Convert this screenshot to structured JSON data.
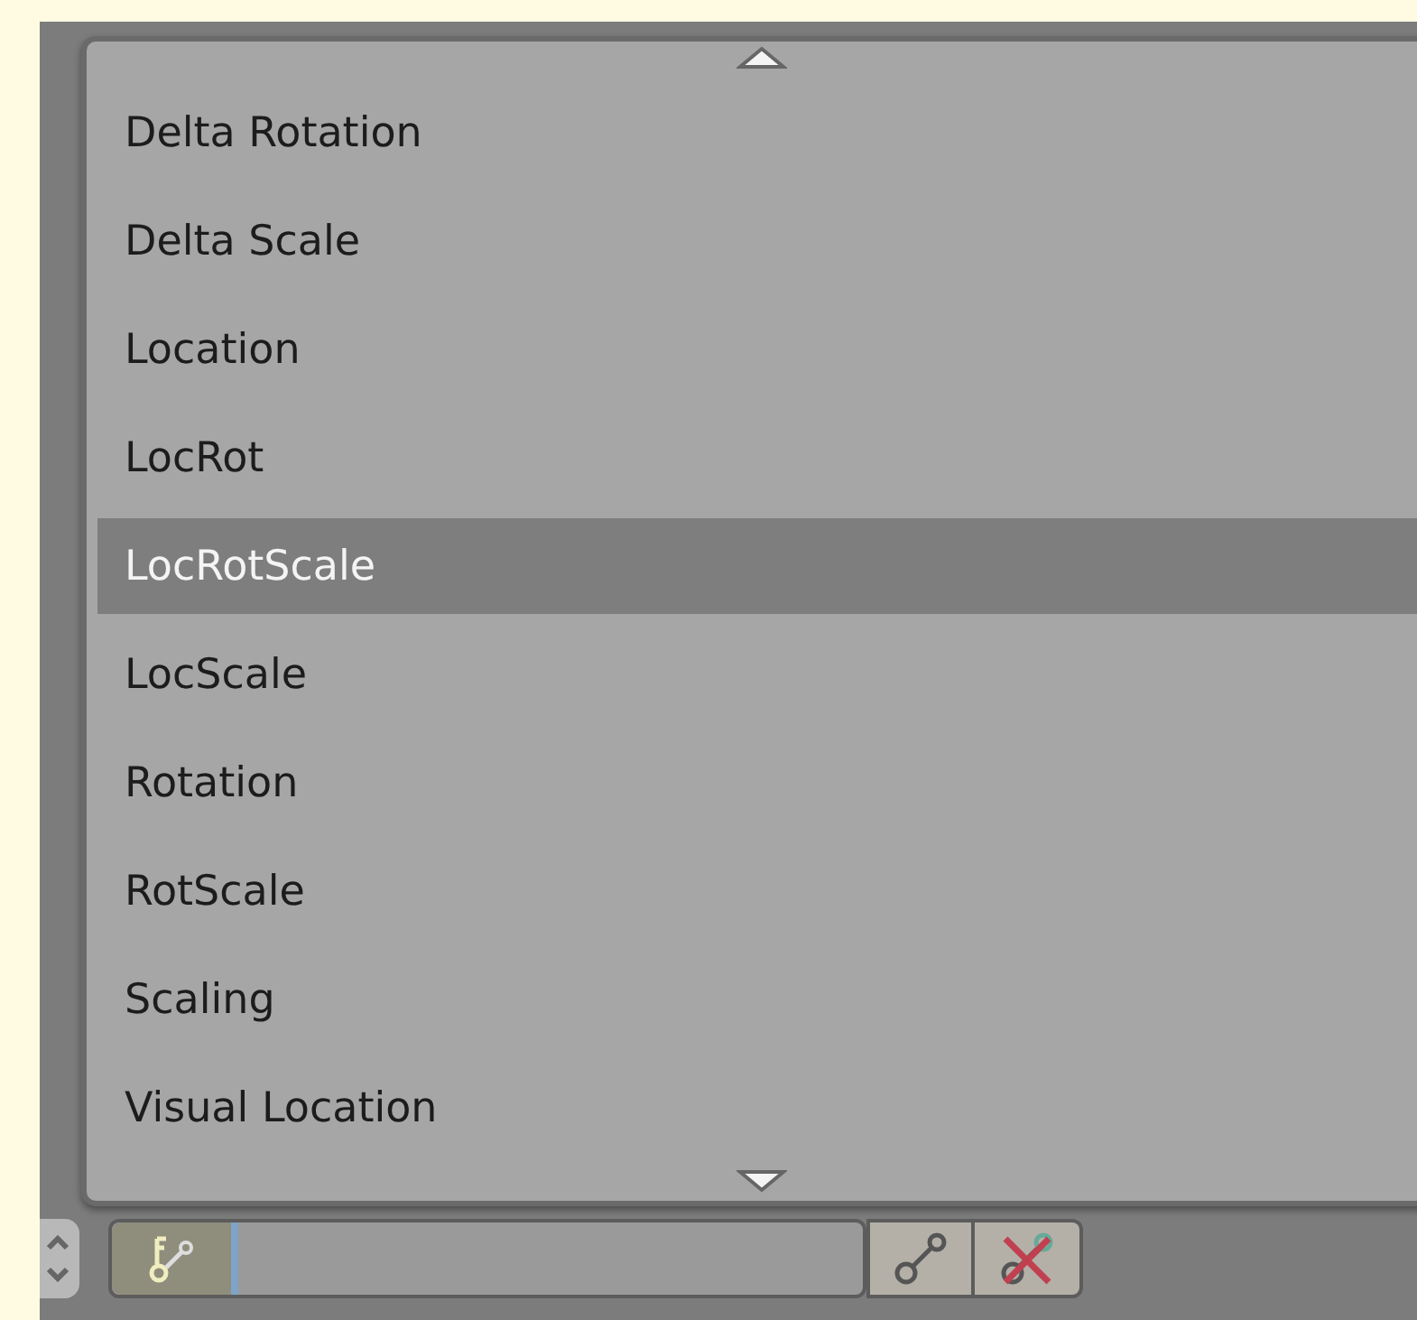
{
  "menu": {
    "items": [
      {
        "label": "Delta Rotation",
        "selected": false
      },
      {
        "label": "Delta Scale",
        "selected": false
      },
      {
        "label": "Location",
        "selected": false
      },
      {
        "label": "LocRot",
        "selected": false
      },
      {
        "label": "LocRotScale",
        "selected": true
      },
      {
        "label": "LocScale",
        "selected": false
      },
      {
        "label": "Rotation",
        "selected": false
      },
      {
        "label": "RotScale",
        "selected": false
      },
      {
        "label": "Scaling",
        "selected": false
      },
      {
        "label": "Visual Location",
        "selected": false
      }
    ]
  }
}
